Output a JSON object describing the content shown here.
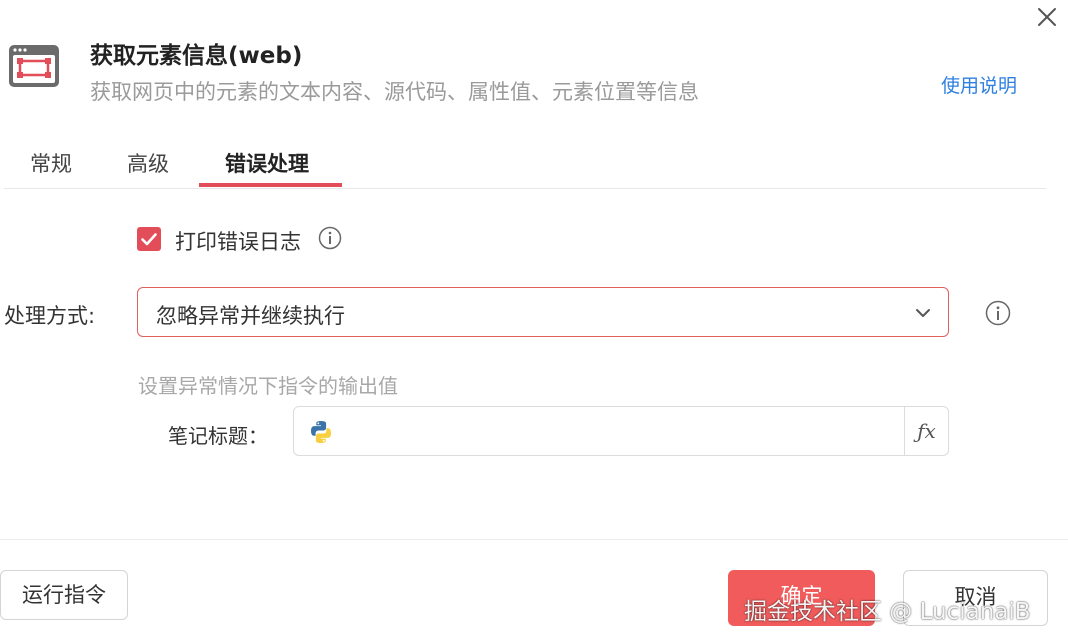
{
  "dialog": {
    "title": "获取元素信息(web)",
    "subtitle": "获取网页中的元素的文本内容、源代码、属性值、元素位置等信息",
    "help_link": "使用说明",
    "close_icon": "close-icon"
  },
  "tabs": [
    {
      "label": "常规",
      "active": false
    },
    {
      "label": "高级",
      "active": false
    },
    {
      "label": "错误处理",
      "active": true
    }
  ],
  "error_handling": {
    "print_log": {
      "label": "打印错误日志",
      "checked": true
    },
    "mode": {
      "label": "处理方式:",
      "value": "忽略异常并继续执行"
    },
    "output_hint": "设置异常情况下指令的输出值",
    "note_title": {
      "label": "笔记标题：",
      "value": ""
    }
  },
  "footer": {
    "run_label": "运行指令",
    "ok_label": "确定",
    "cancel_label": "取消"
  },
  "watermark": "掘金技术社区 @ LucianaiB",
  "colors": {
    "accent": "#e34d59",
    "primary_button": "#f15b5b",
    "link": "#2f7fe0"
  },
  "icons": {
    "app": "browser-element-icon",
    "info": "info-icon",
    "chevron": "chevron-down-icon",
    "python": "python-icon",
    "formula": "fx-icon"
  }
}
